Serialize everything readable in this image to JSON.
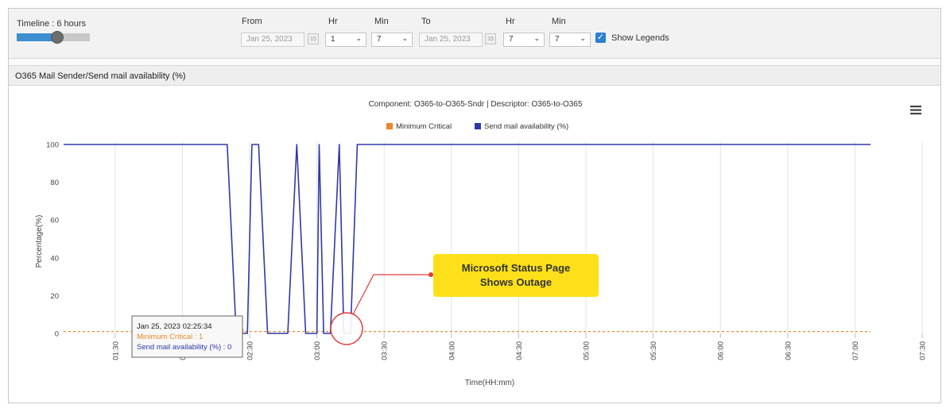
{
  "toolbar": {
    "timeline_label": "Timeline : 6 hours",
    "timeline_fraction": 0.55,
    "from_label": "From",
    "from_date": "Jan 25, 2023",
    "from_hr_label": "Hr",
    "from_hr": "1",
    "from_min_label": "Min",
    "from_min": "7",
    "to_label": "To",
    "to_date": "Jan 25, 2023",
    "to_hr_label": "Hr",
    "to_hr": "7",
    "to_min_label": "Min",
    "to_min": "7",
    "show_legends_label": "Show Legends",
    "show_legends_checked": true
  },
  "panel": {
    "title": "O365 Mail Sender/Send mail availability (%)"
  },
  "icons": {
    "calendar": "calendar-icon",
    "menu": "hamburger-menu-icon",
    "checkbox": "checkbox-checked-icon",
    "chevron": "chevron-down-icon"
  },
  "tooltip": {
    "date": "Jan 25, 2023 02:25:34",
    "min_critical": "Minimum Critical : 1",
    "availability": "Send mail availability  (%) : 0"
  },
  "callout": {
    "line1": "Microsoft Status Page",
    "line2": "Shows Outage"
  },
  "colors": {
    "series": "#3038a8",
    "threshold": "#e8892b",
    "callout_bg": "#fde01a",
    "callout_ring": "#e03c3c"
  },
  "chart_data": {
    "type": "line",
    "title": "Component: O365-to-O365-Sndr | Descriptor: O365-to-O365",
    "xlabel": "Time(HH:mm)",
    "ylabel": "Percentage(%)",
    "ylim": [
      0,
      100
    ],
    "yticks": [
      0,
      20,
      40,
      60,
      80,
      100
    ],
    "xlim": [
      "01:07",
      "07:30"
    ],
    "xticks": [
      "01:30",
      "02:00",
      "02:30",
      "03:00",
      "03:30",
      "04:00",
      "04:30",
      "05:00",
      "05:30",
      "06:00",
      "06:30",
      "07:00",
      "07:30"
    ],
    "grid": true,
    "legend_position": "top",
    "series": [
      {
        "name": "Minimum Critical",
        "style": "dashed",
        "x": [
          "01:07",
          "07:07"
        ],
        "y": [
          1,
          1
        ]
      },
      {
        "name": "Send mail availability (%)",
        "style": "solid",
        "x": [
          "01:07",
          "02:20",
          "02:24",
          "02:29",
          "02:31",
          "02:34",
          "02:38",
          "02:47",
          "02:51",
          "02:55",
          "03:00",
          "03:01",
          "03:03",
          "03:04",
          "03:06",
          "03:10",
          "03:12",
          "03:13",
          "03:15",
          "03:18",
          "07:07"
        ],
        "y": [
          100,
          100,
          0,
          0,
          100,
          100,
          0,
          0,
          100,
          0,
          0,
          100,
          0,
          0,
          0,
          100,
          0,
          0,
          0,
          100,
          100
        ]
      }
    ]
  }
}
